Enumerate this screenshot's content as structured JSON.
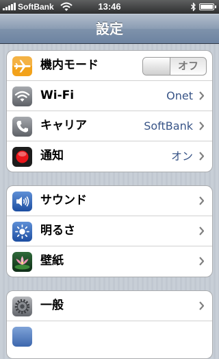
{
  "status_bar": {
    "carrier": "SoftBank",
    "time": "13:46",
    "signal_bars": 5,
    "battery_level": 1.0
  },
  "nav": {
    "title": "設定"
  },
  "groups": [
    {
      "rows": [
        {
          "label": "機内モード",
          "icon": "airplane-icon",
          "toggle_label": "オフ",
          "toggle_on": false
        },
        {
          "label": "Wi-Fi",
          "icon": "wifi-icon",
          "value": "Onet"
        },
        {
          "label": "キャリア",
          "icon": "phone-icon",
          "value": "SoftBank"
        },
        {
          "label": "通知",
          "icon": "notifications-icon",
          "value": "オン"
        }
      ]
    },
    {
      "rows": [
        {
          "label": "サウンド",
          "icon": "speaker-icon"
        },
        {
          "label": "明るさ",
          "icon": "brightness-icon"
        },
        {
          "label": "壁紙",
          "icon": "wallpaper-icon"
        }
      ]
    },
    {
      "rows": [
        {
          "label": "一般",
          "icon": "gear-icon"
        }
      ]
    }
  ],
  "colors": {
    "accent_value_text": "#385487",
    "airplane_icon_bg": "#f2a21b",
    "notifications_dot": "#e8161b"
  }
}
